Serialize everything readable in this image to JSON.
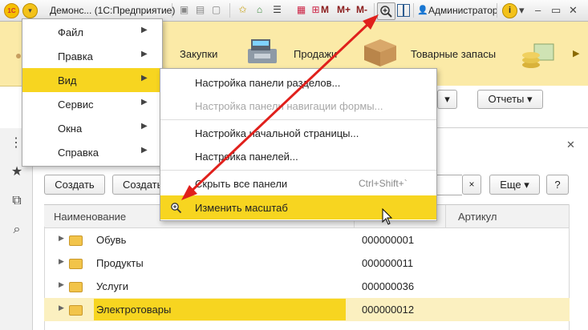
{
  "titlebar": {
    "title": "Демонс... (1С:Предприятие)",
    "m_labels": [
      "M",
      "M+",
      "M-"
    ],
    "user": "Администратор"
  },
  "sections": {
    "items": [
      "Закупки",
      "Продажи",
      "Товарные запасы"
    ]
  },
  "subbar": {
    "reports": "Отчеты"
  },
  "toolbar": {
    "create": "Создать",
    "create_group": "Создать",
    "more": "Еще",
    "help": "?",
    "clear": "×"
  },
  "table": {
    "headers": [
      "Наименование",
      "Артикул"
    ],
    "rows": [
      {
        "name": "Обувь",
        "code": "000000001"
      },
      {
        "name": "Продукты",
        "code": "000000011"
      },
      {
        "name": "Услуги",
        "code": "000000036"
      },
      {
        "name": "Электротовары",
        "code": "000000012"
      }
    ]
  },
  "main_menu": {
    "items": [
      "Файл",
      "Правка",
      "Вид",
      "Сервис",
      "Окна",
      "Справка"
    ],
    "active": "Вид"
  },
  "sub_menu": {
    "items": [
      {
        "label": "Настройка панели разделов...",
        "shortcut": ""
      },
      {
        "label": "Настройка панели навигации формы...",
        "shortcut": ""
      },
      {
        "label": "Настройка начальной страницы...",
        "shortcut": ""
      },
      {
        "label": "Настройка панелей...",
        "shortcut": ""
      },
      {
        "label": "Скрыть все панели",
        "shortcut": "Ctrl+Shift+`"
      },
      {
        "label": "Изменить масштаб",
        "shortcut": ""
      }
    ]
  },
  "colors": {
    "highlight": "#f7d520",
    "sections_bg": "#fbeaa7",
    "arrow": "#e0201c"
  },
  "icons": [
    "1c-logo-icon",
    "main-menu-icon",
    "zoom-icon",
    "panels-icon",
    "user-icon",
    "info-icon",
    "star-icon",
    "history-icon",
    "search-icon",
    "folder-icon"
  ]
}
